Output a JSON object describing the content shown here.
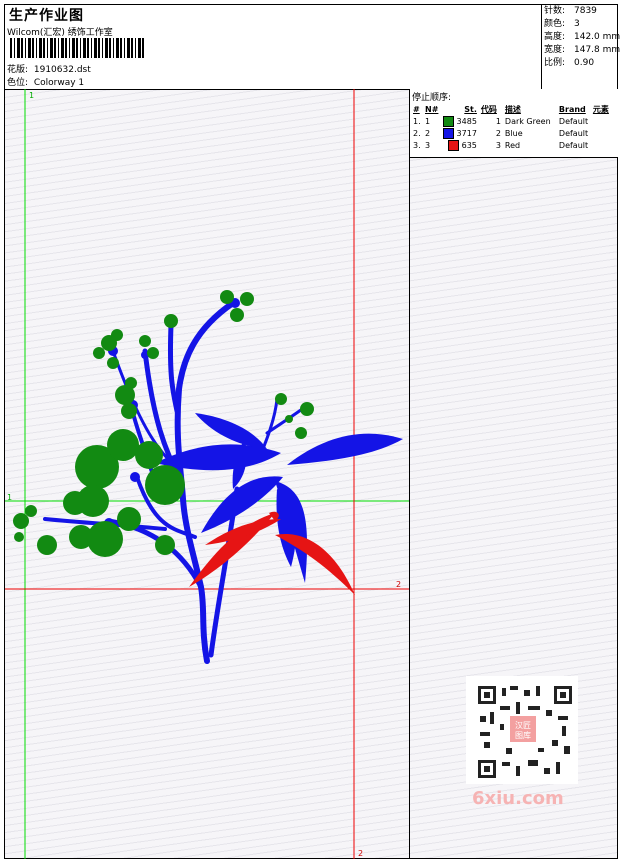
{
  "header": {
    "title": "生产作业图",
    "studio": "Wilcom(汇宏) 绣饰工作室",
    "design_label": "花版:",
    "design_value": "1910632.dst",
    "colorway_label": "色位:",
    "colorway_value": "Colorway 1"
  },
  "stats": [
    {
      "label": "针数:",
      "value": "7839"
    },
    {
      "label": "颜色:",
      "value": "3"
    },
    {
      "label": "高度:",
      "value": "142.0 mm"
    },
    {
      "label": "宽度:",
      "value": "147.8 mm"
    },
    {
      "label": "比例:",
      "value": "0.90"
    }
  ],
  "stop_sequence": {
    "title": "停止顺序:",
    "columns": [
      "#",
      "N#",
      "St.",
      "代码",
      "描述",
      "Brand",
      "元素"
    ],
    "rows": [
      {
        "idx": "1.",
        "n": "1",
        "color": "#128a12",
        "stitches": "3485",
        "code": "1",
        "desc": "Dark Green",
        "brand": "Default"
      },
      {
        "idx": "2.",
        "n": "2",
        "color": "#1414e6",
        "stitches": "3717",
        "code": "2",
        "desc": "Blue",
        "brand": "Default"
      },
      {
        "idx": "3.",
        "n": "3",
        "color": "#e61414",
        "stitches": "635",
        "code": "3",
        "desc": "Red",
        "brand": "Default"
      }
    ]
  },
  "guides": {
    "green_vertical_label": "1",
    "green_horizontal_label": "1",
    "red_horizontal_label": "2",
    "red_vertical_label": "2"
  },
  "watermark": {
    "text": "6xiu.com",
    "qr_center": "汉匠图库"
  },
  "colors": {
    "green": "#128a12",
    "blue": "#1414e6",
    "red": "#e61414",
    "guide_green": "#00dd00",
    "guide_red": "#ee0000"
  }
}
